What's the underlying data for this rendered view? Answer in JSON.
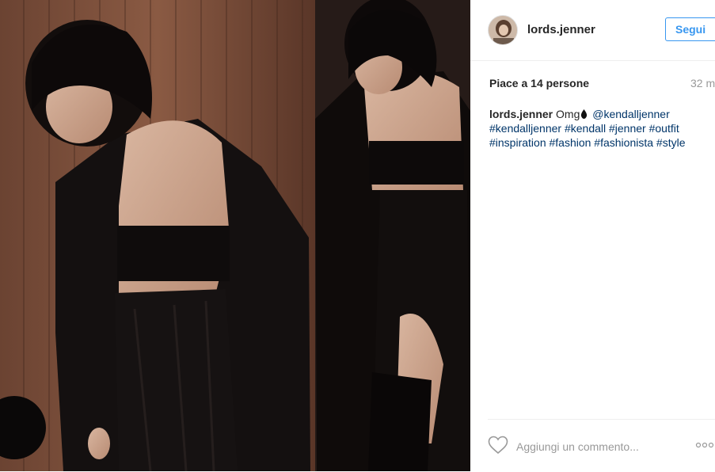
{
  "post": {
    "username": "lords.jenner",
    "follow_label": "Segui",
    "likes_text": "Piace a 14 persone",
    "time_text": "32 m",
    "caption": {
      "username": "lords.jenner",
      "text_before": "Omg",
      "emoji": "black droplet",
      "mention": "@kendalljenner",
      "hashtags_line1": "#kendalljenner #kendall #jenner #outfit",
      "hashtags_line2": "#inspiration #fashion #fashionista #style"
    },
    "comment_placeholder": "Aggiungi un commento...",
    "icons": {
      "like": "heart-outline-icon",
      "more": "ellipsis-icon"
    }
  },
  "colors": {
    "link": "#003569",
    "follow": "#3897f0",
    "muted": "#999999",
    "divider": "#efefef"
  }
}
